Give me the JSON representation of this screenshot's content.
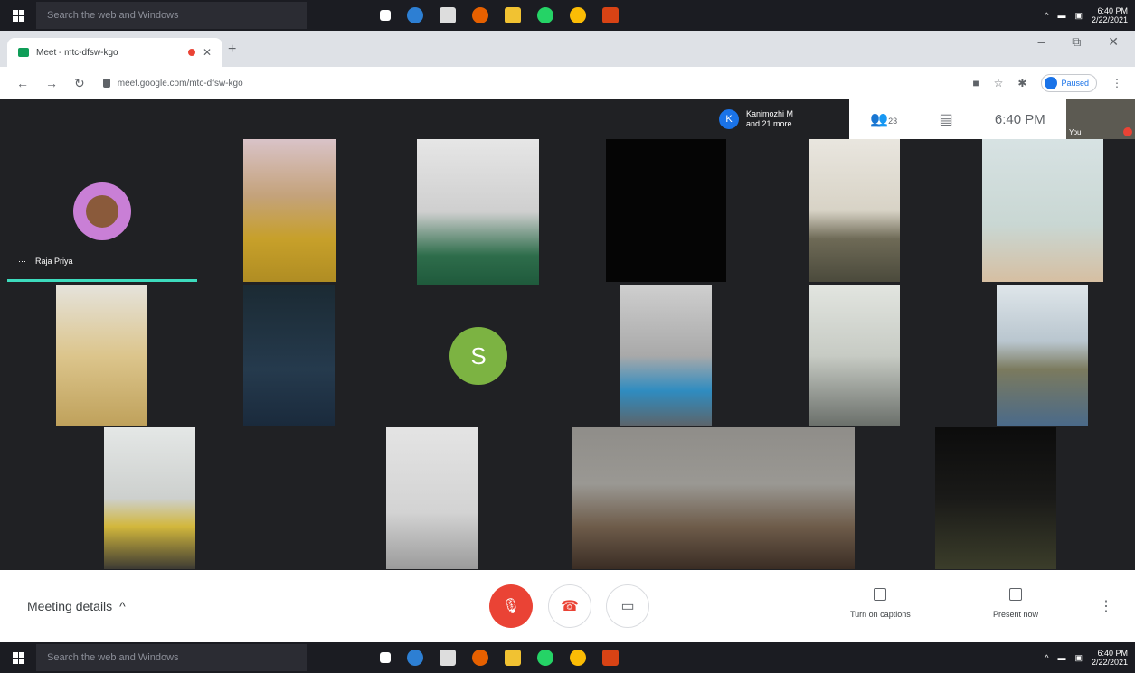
{
  "taskbar": {
    "search_placeholder": "Search the web and Windows",
    "time": "6:40 PM",
    "date": "2/22/2021",
    "icons": [
      "windows-logo-icon",
      "task-view-icon",
      "edge-icon",
      "store-icon",
      "firefox-icon",
      "file-explorer-icon",
      "whatsapp-icon",
      "chrome-icon",
      "app-icon"
    ]
  },
  "browser": {
    "tab_title": "Meet - mtc-dfsw-kgo",
    "new_tab": "+",
    "url": "meet.google.com/mtc-dfsw-kgo",
    "profile_status": "Paused",
    "min": "–",
    "restore": "⧉",
    "close": "✕"
  },
  "meet": {
    "participants_initial": "K",
    "participants_line1": "Kanimozhi M",
    "participants_line2": "and 21 more",
    "people_count": "23",
    "clock": "6:40 PM",
    "self_label": "You",
    "speaker_name": "Raja Priya",
    "speaker_menu": "⋯",
    "avatar_initial": "S"
  },
  "controls": {
    "meeting_details": "Meeting details",
    "captions_label": "Turn on captions",
    "present_label": "Present now"
  },
  "colors": {
    "meet_bg": "#202124",
    "mic_off_red": "#ea4335",
    "speaker_teal": "#3ddbbd",
    "avatar_green": "#7cb342"
  }
}
